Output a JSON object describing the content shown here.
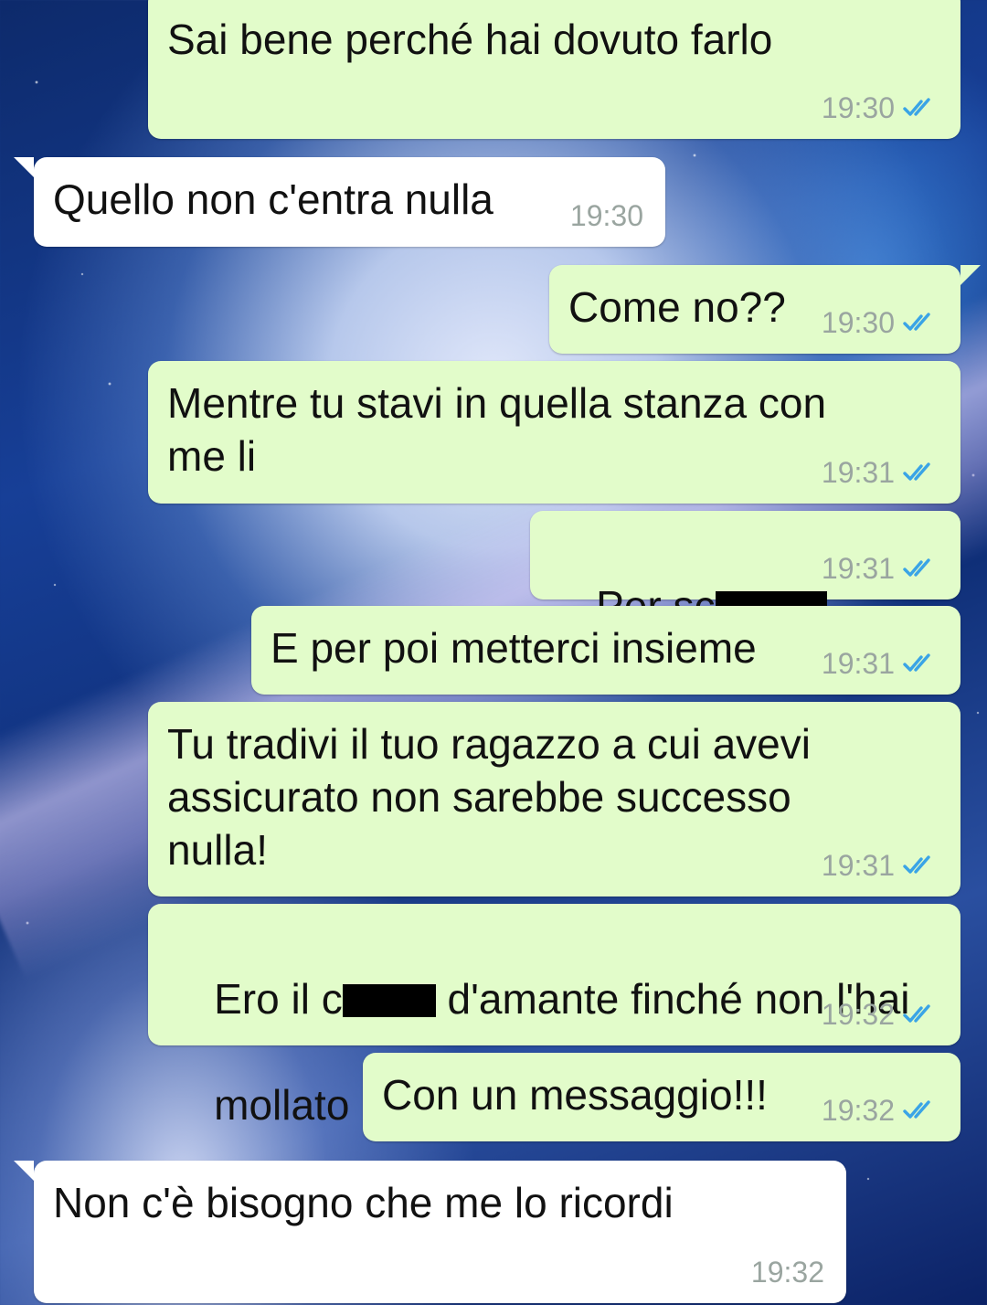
{
  "chat": {
    "messages": [
      {
        "direction": "out",
        "text": "Sai bene perché hai dovuto farlo",
        "time": "19:30",
        "status": "read"
      },
      {
        "direction": "in",
        "text": "Quello non c'entra nulla",
        "time": "19:30"
      },
      {
        "direction": "out",
        "text": "Come no??",
        "time": "19:30",
        "status": "read"
      },
      {
        "direction": "out",
        "text": "Mentre tu stavi in quella stanza con\nme li",
        "time": "19:31",
        "status": "read"
      },
      {
        "direction": "out",
        "text_before": "Per sc",
        "text_after": "",
        "redacted": true,
        "time": "19:31",
        "status": "read"
      },
      {
        "direction": "out",
        "text": "E per poi metterci insieme",
        "time": "19:31",
        "status": "read"
      },
      {
        "direction": "out",
        "text": "Tu tradivi il tuo ragazzo a cui avevi\nassicurato non sarebbe successo\nnulla!",
        "time": "19:31",
        "status": "read"
      },
      {
        "direction": "out",
        "text_before": "Ero il c",
        "text_after": " d'amante finché non l'hai",
        "text_line2": "mollato dopo quella sera",
        "redacted": true,
        "time": "19:32",
        "status": "read"
      },
      {
        "direction": "out",
        "text": "Con un messaggio!!!",
        "time": "19:32",
        "status": "read"
      },
      {
        "direction": "in",
        "text": "Non c'è bisogno che me lo ricordi",
        "time": "19:32"
      }
    ]
  },
  "colors": {
    "outgoing_bubble": "#e2fcca",
    "incoming_bubble": "#ffffff",
    "read_ticks": "#3aa4e6",
    "timestamp": "#9aa5a0"
  },
  "icons": {
    "read_receipt": "double-check-icon"
  }
}
